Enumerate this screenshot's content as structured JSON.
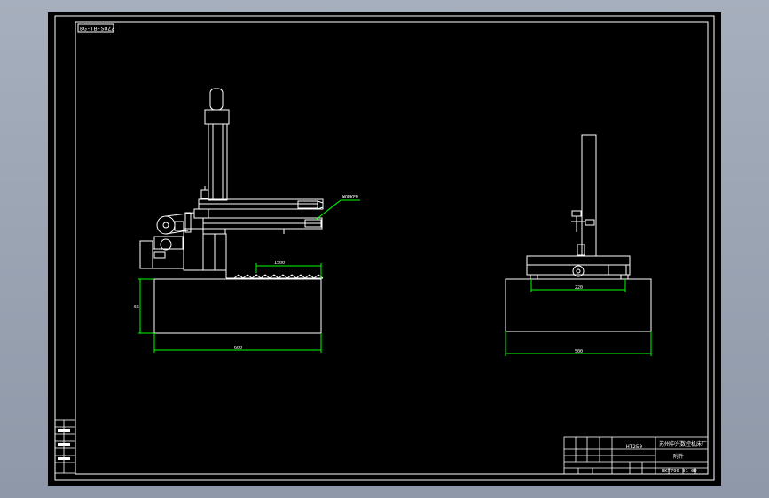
{
  "drawing": {
    "code_box": "BG-TB-SUZZ",
    "leader_label": "WORKER",
    "dims": {
      "rail_length": "1500",
      "left_height": "55",
      "left_width": "600",
      "right_inner": "220",
      "right_width": "500"
    }
  },
  "title_block": {
    "material": "HT250",
    "company": "苏州中兴数控机床厂",
    "drawing_name": "附件",
    "drawing_no": "BKT790-01-00"
  },
  "colors": {
    "background": "#000000",
    "lines": "#ffffff",
    "dimensions": "#00ff00",
    "frame_outer": "#9aa4b4"
  }
}
